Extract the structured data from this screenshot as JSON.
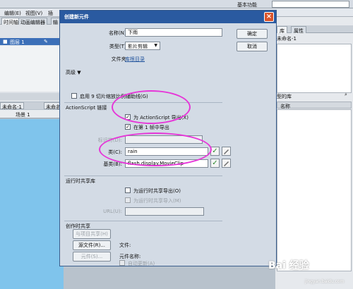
{
  "app": {
    "workspace": "基本功能",
    "menu": [
      "编辑(E)",
      "视图(V)",
      "插"
    ],
    "timeline_tabs": [
      "时间轴",
      "动画编辑器",
      "输"
    ],
    "layer_name": "图层 1",
    "doc_tabs": [
      "未命名-1",
      "未命名"
    ],
    "scene": "场景 1",
    "right_tabs": [
      "库",
      "属性"
    ],
    "right_doc": "未命名-1",
    "library_label": "型的库",
    "library_column": "名称"
  },
  "dialog": {
    "title": "创建新元件",
    "name_label": "名称(N):",
    "name_value": "下雨",
    "type_label": "类型(T):",
    "type_value": "影片剪辑",
    "folder_label": "文件夹:",
    "folder_value": "库根目录",
    "ok_button": "确定",
    "cancel_button": "取消",
    "advanced_toggle": "高级 ▼",
    "slice_guides": "启用 9 切片缩放比例辅助线(G)",
    "linkage_title": "ActionScript 链接",
    "export_as": "为 ActionScript 导出(X)",
    "export_frame1": "在第 1 帧中导出",
    "identifier_label": "标识符(D):",
    "class_label": "类(C):",
    "class_value": "rain",
    "base_class_label": "基类(B):",
    "base_class_value": "flash.display.MovieClip",
    "runtime_title": "运行时共享库",
    "runtime_export": "为运行时共享导出(O)",
    "runtime_import": "为运行时共享导入(M)",
    "url_label": "URL(U):",
    "authoring_title": "创作时共享",
    "share_project": "与项目共享(H)",
    "source_file_button": "源文件(R)...",
    "file_label": "文件:",
    "symbol_button": "元件(S)...",
    "symbol_name_label": "元件名称:",
    "auto_update": "自动更新(A)"
  },
  "watermark": "Bai 经验",
  "watermark_sub": "jingyan.baidu.com"
}
